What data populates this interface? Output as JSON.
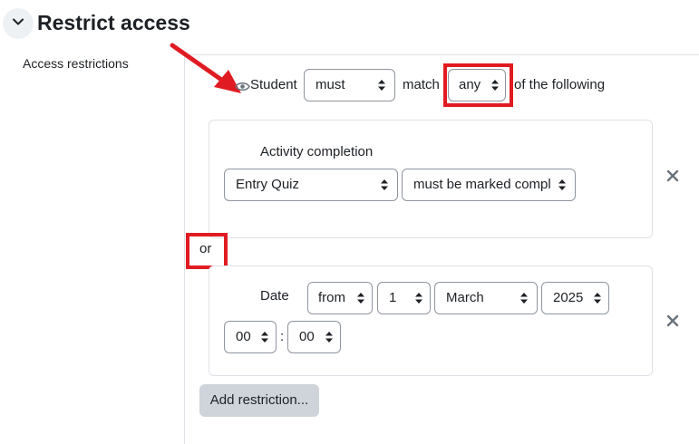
{
  "section": {
    "title": "Restrict access",
    "collapse_icon": "chevron-down-icon"
  },
  "field_label": "Access restrictions",
  "header_row": {
    "eye_icon": "eye-icon",
    "student_label": "Student",
    "must_select": "must",
    "match_label": "match",
    "any_select": "any",
    "of_following": "of the following"
  },
  "operator_label": "or",
  "conditions": [
    {
      "label": "Activity completion",
      "activity_select": "Entry Quiz",
      "state_select": "must be marked compl"
    },
    {
      "label": "Date",
      "direction_select": "from",
      "day_select": "1",
      "month_select": "March",
      "year_select": "2025",
      "hour_select": "00",
      "time_separator": ":",
      "minute_select": "00"
    }
  ],
  "delete_icon": "close-icon",
  "add_button_label": "Add restriction...",
  "colors": {
    "annotation_red": "#e11b22",
    "border": "#dee2e6",
    "button_bg": "#ced4da"
  }
}
